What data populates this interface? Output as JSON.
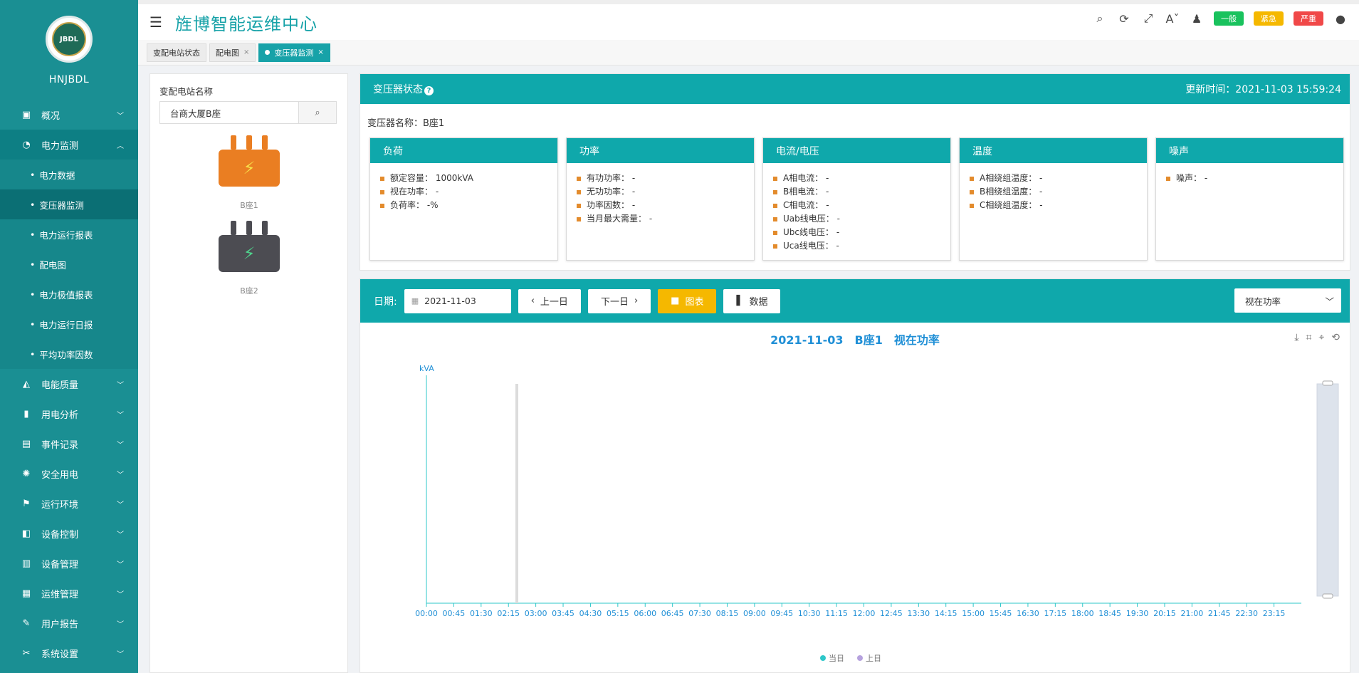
{
  "sidebar": {
    "logo_text": "JBDL",
    "org": "HNJBDL",
    "menu": [
      {
        "label": "概况",
        "icon": "monitor-icon"
      },
      {
        "label": "电力监测",
        "icon": "power-icon",
        "open": true
      },
      {
        "label": "电能质量",
        "icon": "area-chart-icon"
      },
      {
        "label": "用电分析",
        "icon": "bar-chart-icon"
      },
      {
        "label": "事件记录",
        "icon": "book-icon"
      },
      {
        "label": "安全用电",
        "icon": "alarm-light-icon"
      },
      {
        "label": "运行环境",
        "icon": "flag-icon"
      },
      {
        "label": "设备控制",
        "icon": "control-icon"
      },
      {
        "label": "设备管理",
        "icon": "server-icon"
      },
      {
        "label": "运维管理",
        "icon": "dashboard-icon"
      },
      {
        "label": "用户报告",
        "icon": "edit-icon"
      },
      {
        "label": "系统设置",
        "icon": "tools-icon"
      }
    ],
    "submenu": [
      {
        "label": "电力数据"
      },
      {
        "label": "变压器监测",
        "active": true
      },
      {
        "label": "电力运行报表"
      },
      {
        "label": "配电图"
      },
      {
        "label": "电力极值报表"
      },
      {
        "label": "电力运行日报"
      },
      {
        "label": "平均功率因数"
      }
    ]
  },
  "header": {
    "title": "旌博智能运维中心",
    "badges": {
      "normal": "一般",
      "urgent": "紧急",
      "severe": "严重"
    }
  },
  "tabs": [
    {
      "label": "变配电站状态",
      "closable": false
    },
    {
      "label": "配电图",
      "closable": true
    },
    {
      "label": "变压器监测",
      "closable": true,
      "active": true
    }
  ],
  "station": {
    "label": "变配电站名称",
    "value": "台商大厦B座",
    "transformers": [
      {
        "name": "B座1",
        "color": "#ea7e22"
      },
      {
        "name": "B座2",
        "color": "#4c4c52"
      }
    ]
  },
  "status": {
    "title": "变压器状态",
    "update_label": "更新时间：",
    "update_time": "2021-11-03 15:59:24",
    "name_label": "变压器名称：",
    "name_value": "B座1",
    "cards": [
      {
        "title": "负荷",
        "rows": [
          "额定容量：  1000kVA",
          "视在功率：  -",
          "负荷率：  -%"
        ]
      },
      {
        "title": "功率",
        "rows": [
          "有功功率：  -",
          "无功功率：  -",
          "功率因数：  -",
          "当月最大需量：  -"
        ]
      },
      {
        "title": "电流/电压",
        "rows": [
          "A相电流：  -",
          "B相电流：  -",
          "C相电流：  -",
          "Uab线电压：  -",
          "Ubc线电压：  -",
          "Uca线电压：  -"
        ]
      },
      {
        "title": "温度",
        "rows": [
          "A相绕组温度：  -",
          "B相绕组温度：  -",
          "C相绕组温度：  -"
        ]
      },
      {
        "title": "噪声",
        "rows": [
          "噪声：  -"
        ]
      }
    ]
  },
  "toolbar": {
    "date_label": "日期:",
    "date_value": "2021-11-03",
    "prev": "上一日",
    "next": "下一日",
    "chart_btn": "图表",
    "data_btn": "数据",
    "select_value": "视在功率"
  },
  "chart_data": {
    "type": "line",
    "title": "2021-11-03　B座1　视在功率",
    "ylabel": "kVA",
    "x": [
      "00:00",
      "00:45",
      "01:30",
      "02:15",
      "03:00",
      "03:45",
      "04:30",
      "05:15",
      "06:00",
      "06:45",
      "07:30",
      "08:15",
      "09:00",
      "09:45",
      "10:30",
      "11:15",
      "12:00",
      "12:45",
      "13:30",
      "14:15",
      "15:00",
      "15:45",
      "16:30",
      "17:15",
      "18:00",
      "18:45",
      "19:30",
      "20:15",
      "21:00",
      "21:45",
      "22:30",
      "23:15"
    ],
    "series": [
      {
        "name": "当日",
        "color": "#2ec7c9",
        "values": []
      },
      {
        "name": "上日",
        "color": "#b6a2de",
        "values": []
      }
    ],
    "legend": "bottom-center",
    "grid": false
  }
}
